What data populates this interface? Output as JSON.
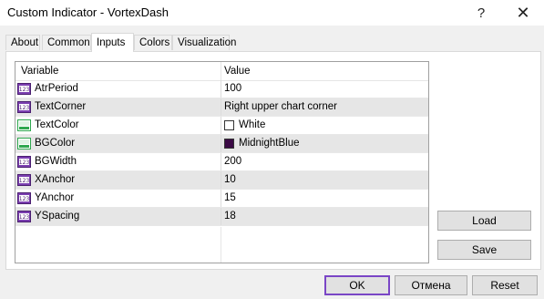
{
  "window": {
    "title": "Custom Indicator - VortexDash",
    "help_glyph": "?",
    "close_glyph": "✕"
  },
  "tabs": [
    "About",
    "Common",
    "Inputs",
    "Colors",
    "Visualization"
  ],
  "active_tab": "Inputs",
  "grid": {
    "headers": {
      "variable": "Variable",
      "value": "Value"
    },
    "rows": [
      {
        "name": "AtrPeriod",
        "value": "100",
        "icon": "int-icon"
      },
      {
        "name": "TextCorner",
        "value": "Right upper chart corner",
        "icon": "int-icon"
      },
      {
        "name": "TextColor",
        "value": "White",
        "icon": "color-icon",
        "swatch": "#ffffff"
      },
      {
        "name": "BGColor",
        "value": "MidnightBlue",
        "icon": "color-icon",
        "swatch": "#3b0a45"
      },
      {
        "name": "BGWidth",
        "value": "200",
        "icon": "int-icon"
      },
      {
        "name": "XAnchor",
        "value": "10",
        "icon": "int-icon"
      },
      {
        "name": "YAnchor",
        "value": "15",
        "icon": "int-icon"
      },
      {
        "name": "YSpacing",
        "value": "18",
        "icon": "int-icon"
      }
    ]
  },
  "side_buttons": {
    "load": "Load",
    "save": "Save"
  },
  "footer_buttons": {
    "ok": "OK",
    "cancel": "Отмена",
    "reset": "Reset"
  },
  "colors": {
    "ok_focus_border": "#7a46c6",
    "int_icon": "#7b3fb0",
    "color_icon": "#2fa84f",
    "alt_row": "#e6e6e6"
  }
}
